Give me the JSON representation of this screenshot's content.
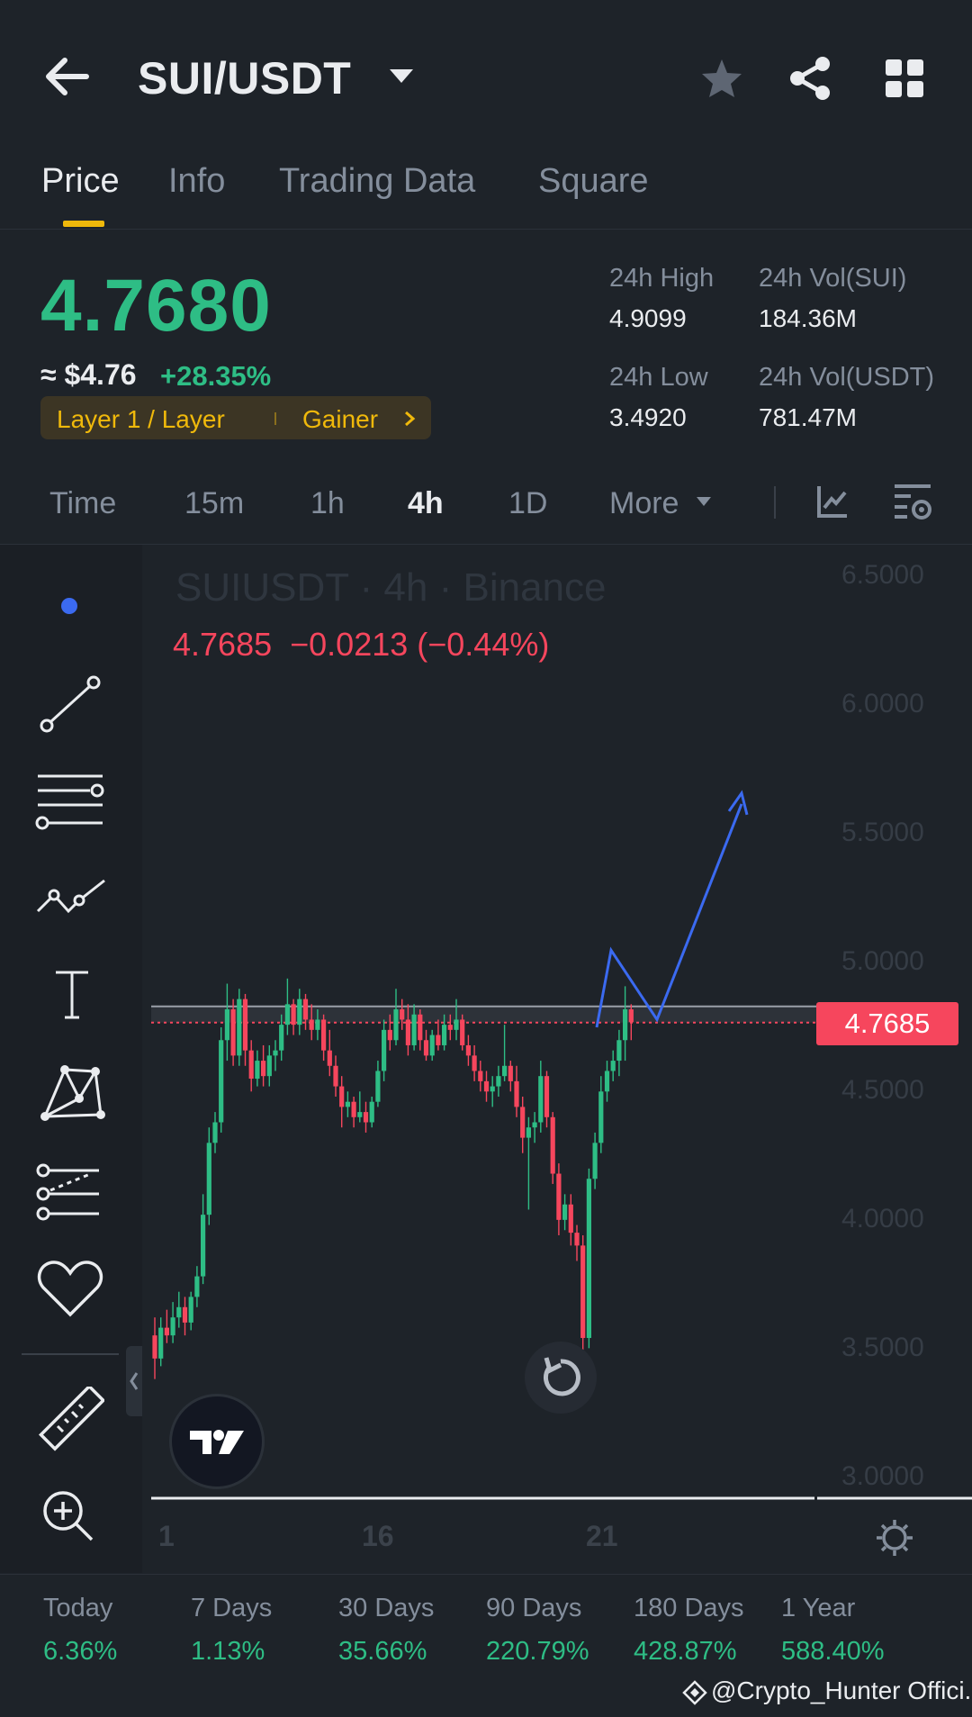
{
  "header": {
    "pair": "SUI/USDT",
    "icons": [
      "back-arrow-icon",
      "chevron-down-icon",
      "star-icon",
      "share-icon",
      "grid-icon"
    ]
  },
  "tabs": [
    {
      "label": "Price",
      "active": true
    },
    {
      "label": "Info",
      "active": false
    },
    {
      "label": "Trading Data",
      "active": false
    },
    {
      "label": "Square",
      "active": false
    }
  ],
  "ticker": {
    "last_price": "4.7680",
    "usd_price": "≈ $4.76",
    "change_pct": "+28.35%",
    "tag_category": "Layer 1 / Layer",
    "tag_label": "Gainer",
    "high_label": "24h High",
    "high_value": "4.9099",
    "low_label": "24h Low",
    "low_value": "3.4920",
    "vol_base_label": "24h Vol(SUI)",
    "vol_base_value": "184.36M",
    "vol_quote_label": "24h Vol(USDT)",
    "vol_quote_value": "781.47M"
  },
  "intervals": {
    "items": [
      "Time",
      "15m",
      "1h",
      "4h",
      "1D"
    ],
    "active": "4h",
    "more_label": "More"
  },
  "chart": {
    "watermark": "SUIUSDT · 4h · Binance",
    "ohlc_price": "4.7685",
    "ohlc_change": "−0.0213 (−0.44%)",
    "price_axis": [
      "6.5000",
      "6.0000",
      "5.5000",
      "5.0000",
      "4.5000",
      "4.0000",
      "3.5000",
      "3.0000"
    ],
    "current_price_tag": "4.7685",
    "date_labels": [
      "1",
      "16",
      "21"
    ],
    "colors": {
      "up": "#2ebd85",
      "down": "#f6465d",
      "projection": "#3b6af0",
      "accent": "#f0b90b"
    },
    "tool_icons": [
      "dot-cursor-icon",
      "trend-line-icon",
      "fib-lines-icon",
      "pattern-icon",
      "text-tool-icon",
      "xabcd-pattern-icon",
      "projection-icon",
      "favorites-heart-icon",
      "ruler-icon",
      "zoom-in-icon"
    ]
  },
  "chart_data": {
    "type": "candlestick",
    "interval": "4h",
    "y_range": [
      3.0,
      6.5
    ],
    "horizontal_line": 4.8,
    "projection_path": [
      4.75,
      5.05,
      4.78,
      5.62
    ],
    "candles": [
      [
        3.55,
        3.62,
        3.38,
        3.46
      ],
      [
        3.46,
        3.62,
        3.43,
        3.58
      ],
      [
        3.58,
        3.65,
        3.52,
        3.55
      ],
      [
        3.55,
        3.68,
        3.52,
        3.62
      ],
      [
        3.62,
        3.72,
        3.58,
        3.66
      ],
      [
        3.66,
        3.7,
        3.55,
        3.6
      ],
      [
        3.6,
        3.72,
        3.57,
        3.7
      ],
      [
        3.7,
        3.82,
        3.66,
        3.78
      ],
      [
        3.78,
        4.1,
        3.75,
        4.02
      ],
      [
        4.02,
        4.36,
        3.98,
        4.3
      ],
      [
        4.3,
        4.42,
        4.26,
        4.38
      ],
      [
        4.38,
        4.75,
        4.34,
        4.7
      ],
      [
        4.7,
        4.92,
        4.62,
        4.82
      ],
      [
        4.82,
        4.86,
        4.6,
        4.64
      ],
      [
        4.64,
        4.9,
        4.6,
        4.86
      ],
      [
        4.86,
        4.88,
        4.6,
        4.66
      ],
      [
        4.66,
        4.7,
        4.5,
        4.55
      ],
      [
        4.55,
        4.66,
        4.52,
        4.62
      ],
      [
        4.62,
        4.68,
        4.52,
        4.56
      ],
      [
        4.56,
        4.68,
        4.52,
        4.64
      ],
      [
        4.64,
        4.7,
        4.58,
        4.66
      ],
      [
        4.66,
        4.8,
        4.62,
        4.76
      ],
      [
        4.76,
        4.94,
        4.72,
        4.84
      ],
      [
        4.84,
        4.86,
        4.72,
        4.76
      ],
      [
        4.76,
        4.9,
        4.72,
        4.86
      ],
      [
        4.86,
        4.88,
        4.74,
        4.78
      ],
      [
        4.78,
        4.84,
        4.7,
        4.74
      ],
      [
        4.74,
        4.82,
        4.7,
        4.78
      ],
      [
        4.78,
        4.8,
        4.62,
        4.66
      ],
      [
        4.66,
        4.74,
        4.56,
        4.6
      ],
      [
        4.6,
        4.64,
        4.48,
        4.52
      ],
      [
        4.52,
        4.56,
        4.36,
        4.44
      ],
      [
        4.44,
        4.5,
        4.4,
        4.46
      ],
      [
        4.46,
        4.48,
        4.36,
        4.4
      ],
      [
        4.4,
        4.5,
        4.38,
        4.42
      ],
      [
        4.42,
        4.46,
        4.34,
        4.38
      ],
      [
        4.38,
        4.48,
        4.36,
        4.46
      ],
      [
        4.46,
        4.62,
        4.44,
        4.58
      ],
      [
        4.58,
        4.78,
        4.54,
        4.74
      ],
      [
        4.74,
        4.8,
        4.66,
        4.7
      ],
      [
        4.7,
        4.9,
        4.68,
        4.82
      ],
      [
        4.82,
        4.86,
        4.74,
        4.78
      ],
      [
        4.78,
        4.84,
        4.64,
        4.68
      ],
      [
        4.68,
        4.84,
        4.66,
        4.8
      ],
      [
        4.8,
        4.82,
        4.66,
        4.7
      ],
      [
        4.7,
        4.74,
        4.62,
        4.64
      ],
      [
        4.64,
        4.74,
        4.62,
        4.72
      ],
      [
        4.72,
        4.78,
        4.66,
        4.68
      ],
      [
        4.68,
        4.8,
        4.66,
        4.76
      ],
      [
        4.76,
        4.8,
        4.7,
        4.74
      ],
      [
        4.74,
        4.86,
        4.7,
        4.78
      ],
      [
        4.78,
        4.8,
        4.66,
        4.68
      ],
      [
        4.68,
        4.72,
        4.6,
        4.64
      ],
      [
        4.64,
        4.68,
        4.54,
        4.58
      ],
      [
        4.58,
        4.62,
        4.5,
        4.54
      ],
      [
        4.54,
        4.58,
        4.46,
        4.5
      ],
      [
        4.5,
        4.56,
        4.44,
        4.52
      ],
      [
        4.52,
        4.6,
        4.48,
        4.56
      ],
      [
        4.56,
        4.76,
        4.54,
        4.6
      ],
      [
        4.6,
        4.62,
        4.5,
        4.54
      ],
      [
        4.54,
        4.6,
        4.4,
        4.44
      ],
      [
        4.44,
        4.48,
        4.26,
        4.32
      ],
      [
        4.32,
        4.4,
        4.04,
        4.36
      ],
      [
        4.36,
        4.42,
        4.3,
        4.38
      ],
      [
        4.38,
        4.62,
        4.34,
        4.56
      ],
      [
        4.56,
        4.58,
        4.36,
        4.4
      ],
      [
        4.4,
        4.42,
        4.14,
        4.18
      ],
      [
        4.18,
        4.22,
        3.94,
        4.0
      ],
      [
        4.0,
        4.1,
        3.96,
        4.06
      ],
      [
        4.06,
        4.1,
        3.9,
        3.95
      ],
      [
        3.95,
        3.98,
        3.84,
        3.9
      ],
      [
        3.9,
        3.94,
        3.49,
        3.54
      ],
      [
        3.54,
        4.2,
        3.5,
        4.16
      ],
      [
        4.16,
        4.34,
        4.12,
        4.3
      ],
      [
        4.3,
        4.56,
        4.26,
        4.5
      ],
      [
        4.5,
        4.62,
        4.46,
        4.58
      ],
      [
        4.58,
        4.66,
        4.54,
        4.62
      ],
      [
        4.62,
        4.74,
        4.56,
        4.7
      ],
      [
        4.7,
        4.91,
        4.62,
        4.82
      ],
      [
        4.82,
        4.84,
        4.7,
        4.77
      ]
    ]
  },
  "performance": [
    {
      "label": "Today",
      "value": "6.36%"
    },
    {
      "label": "7 Days",
      "value": "1.13%"
    },
    {
      "label": "30 Days",
      "value": "35.66%"
    },
    {
      "label": "90 Days",
      "value": "220.79%"
    },
    {
      "label": "180 Days",
      "value": "428.87%"
    },
    {
      "label": "1 Year",
      "value": "588.40%"
    }
  ],
  "credit": "@Crypto_Hunter Offici..."
}
